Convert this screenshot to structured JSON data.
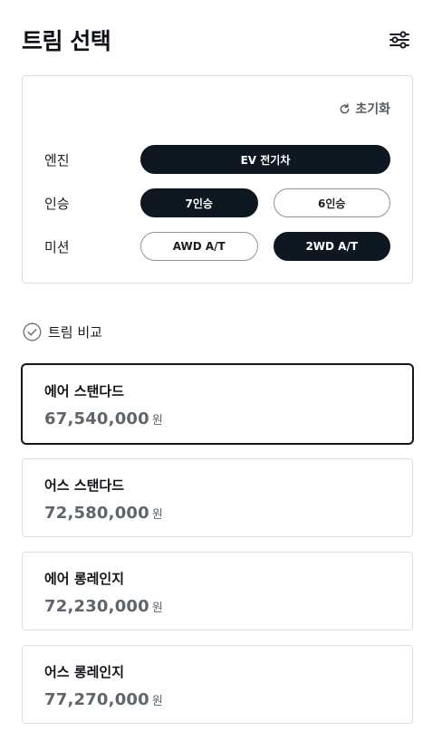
{
  "header": {
    "title": "트림 선택",
    "filter_icon": "sliders-icon"
  },
  "options": {
    "reset_label": "초기화",
    "rows": [
      {
        "label": "엔진",
        "choices": [
          {
            "label": "EV 전기차",
            "selected": true
          }
        ]
      },
      {
        "label": "인승",
        "choices": [
          {
            "label": "7인승",
            "selected": true
          },
          {
            "label": "6인승",
            "selected": false
          }
        ]
      },
      {
        "label": "미션",
        "choices": [
          {
            "label": "AWD A/T",
            "selected": false
          },
          {
            "label": "2WD A/T",
            "selected": true
          }
        ]
      }
    ]
  },
  "compare": {
    "label": "트림 비교"
  },
  "trims": [
    {
      "name": "에어 스탠다드",
      "price": "67,540,000",
      "unit": "원",
      "selected": true
    },
    {
      "name": "어스 스탠다드",
      "price": "72,580,000",
      "unit": "원",
      "selected": false
    },
    {
      "name": "에어 롱레인지",
      "price": "72,230,000",
      "unit": "원",
      "selected": false
    },
    {
      "name": "어스 롱레인지",
      "price": "77,270,000",
      "unit": "원",
      "selected": false
    }
  ],
  "colors": {
    "primary": "#0f1820",
    "border": "#dcdde0",
    "price": "#5f656c"
  }
}
